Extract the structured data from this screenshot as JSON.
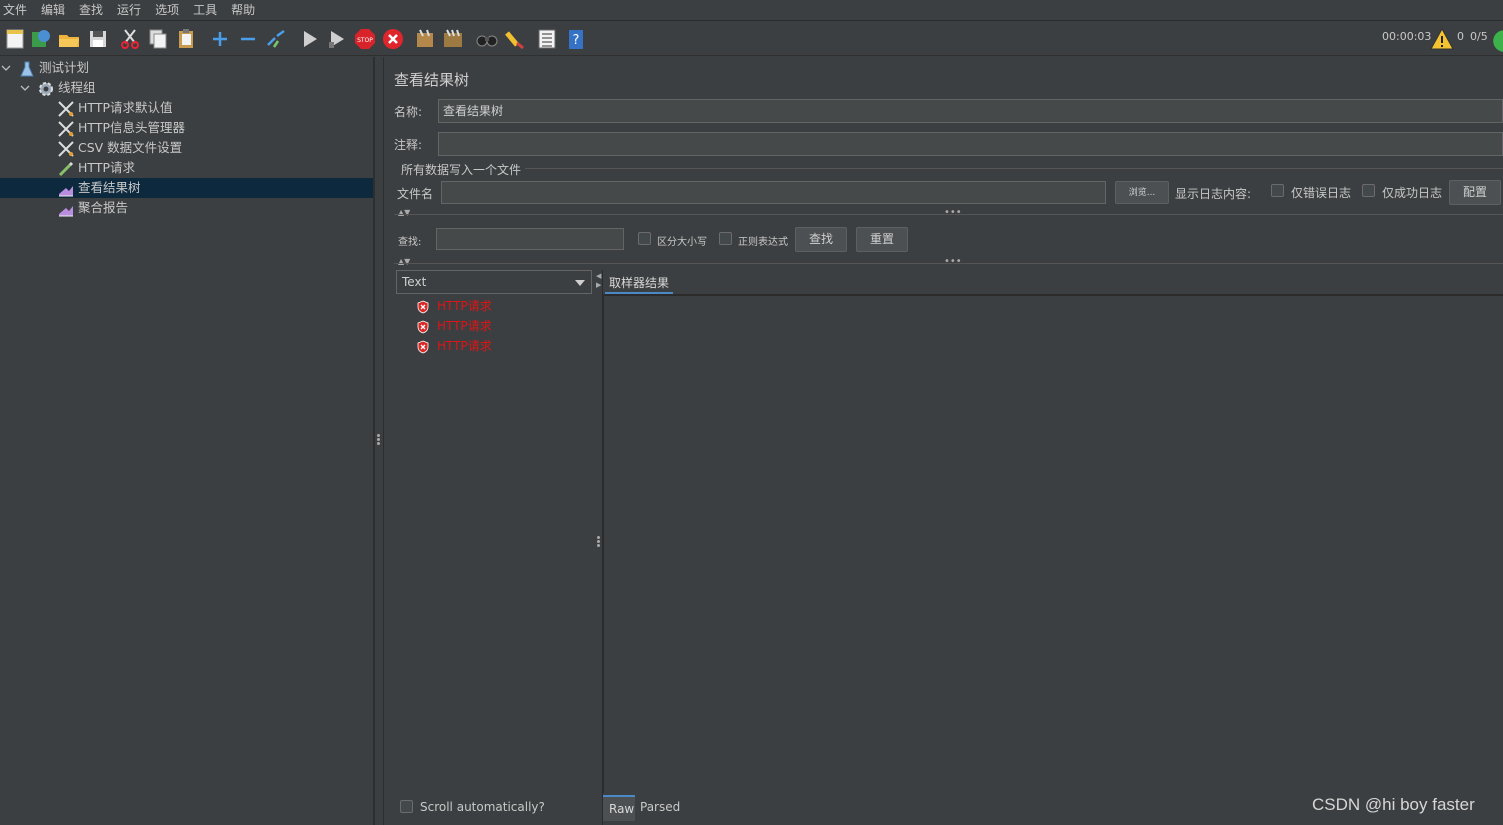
{
  "menu": [
    "文件",
    "编辑",
    "查找",
    "运行",
    "选项",
    "工具",
    "帮助"
  ],
  "status": {
    "timer": "00:00:03",
    "warnings": "0",
    "threads": "0/5"
  },
  "tree": [
    {
      "label": "测试计划",
      "icon": "flask-icon",
      "level": 0,
      "expanded": true
    },
    {
      "label": "线程组",
      "icon": "gear-icon",
      "level": 1,
      "expanded": true
    },
    {
      "label": "HTTP请求默认值",
      "icon": "wrench-icon",
      "level": 2
    },
    {
      "label": "HTTP信息头管理器",
      "icon": "wrench-icon",
      "level": 2
    },
    {
      "label": "CSV 数据文件设置",
      "icon": "wrench-icon",
      "level": 2
    },
    {
      "label": "HTTP请求",
      "icon": "pipette-icon",
      "level": 2
    },
    {
      "label": "查看结果树",
      "icon": "chart-icon",
      "level": 2,
      "selected": true
    },
    {
      "label": "聚合报告",
      "icon": "chart-icon",
      "level": 2
    }
  ],
  "panel": {
    "title": "查看结果树",
    "name_label": "名称:",
    "name_value": "查看结果树",
    "comment_label": "注释:",
    "comment_value": "",
    "file_section": "所有数据写入一个文件",
    "filename_label": "文件名",
    "filename_value": "",
    "browse_label": "浏览...",
    "show_log_label": "显示日志内容:",
    "errors_only_label": "仅错误日志",
    "success_only_label": "仅成功日志",
    "configure_label": "配置"
  },
  "search": {
    "label": "查找:",
    "value": "",
    "case_label": "区分大小写",
    "regex_label": "正则表达式",
    "find_label": "查找",
    "reset_label": "重置"
  },
  "renderer": {
    "selected": "Text"
  },
  "results": [
    "HTTP请求",
    "HTTP请求",
    "HTTP请求"
  ],
  "result_tab": "取样器结果",
  "scroll_label": "Scroll automatically?",
  "bottom_tabs": {
    "raw": "Raw",
    "parsed": "Parsed"
  },
  "watermark": "CSDN @hi boy faster"
}
